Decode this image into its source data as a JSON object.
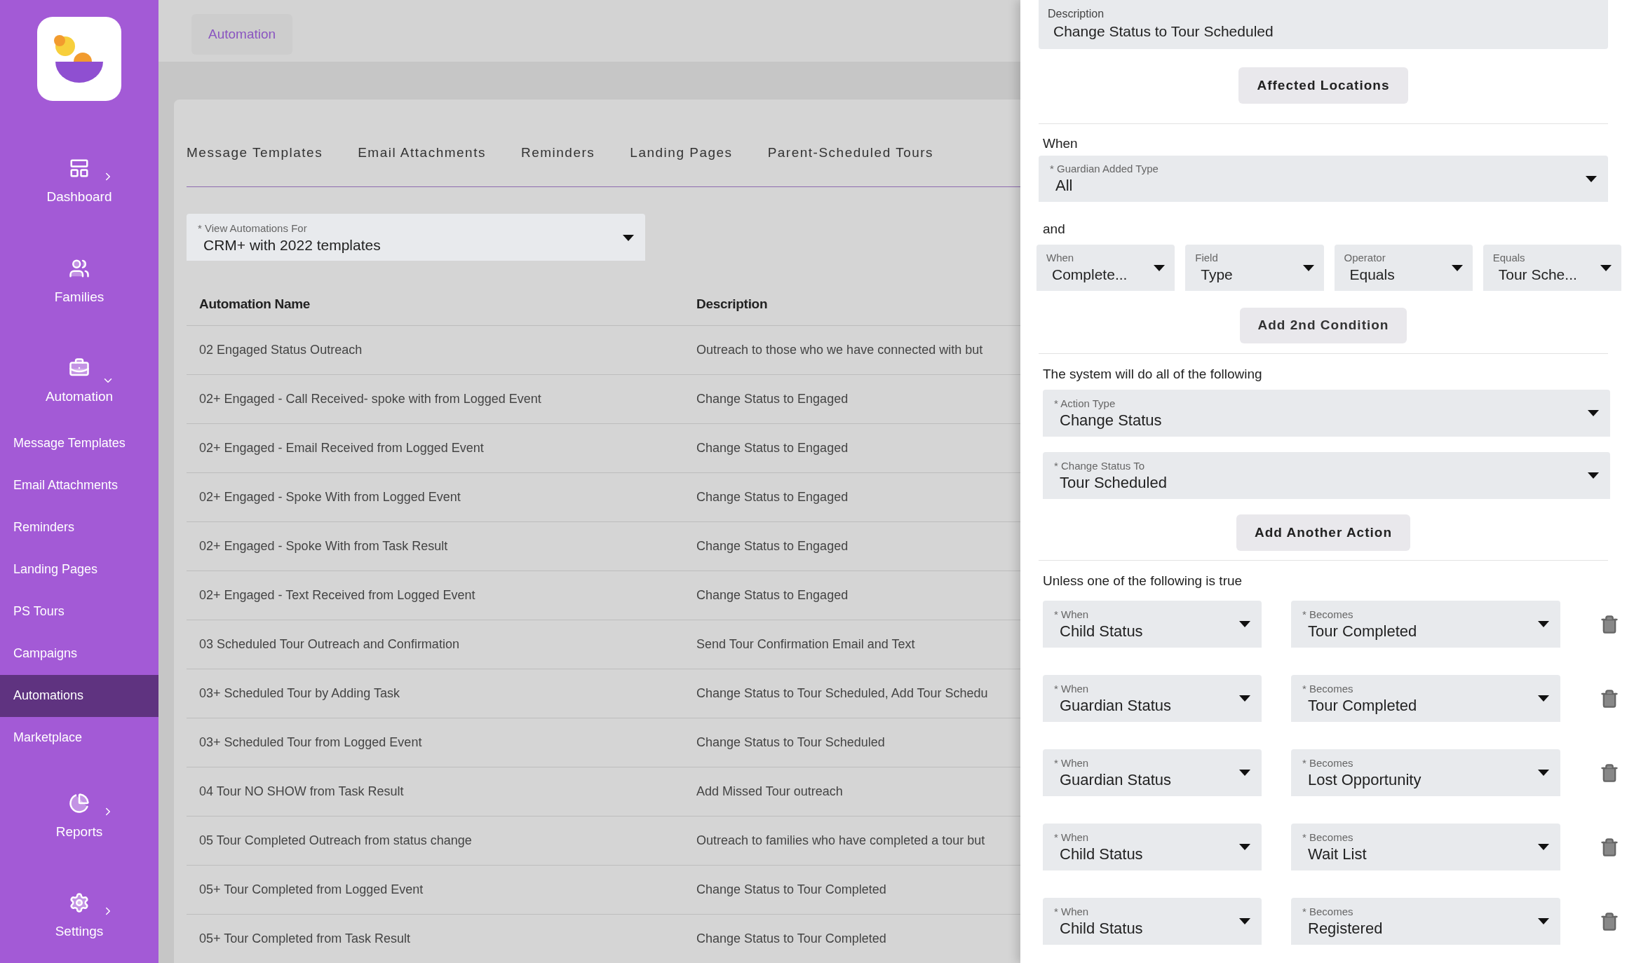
{
  "sidebar": {
    "items": [
      {
        "kind": "group",
        "label": "Dashboard",
        "expanded": false
      },
      {
        "kind": "link",
        "label": "Families"
      },
      {
        "kind": "group",
        "label": "Automation",
        "expanded": true
      },
      {
        "kind": "sub",
        "label": "Message Templates",
        "selected": false
      },
      {
        "kind": "sub",
        "label": "Email Attachments",
        "selected": false
      },
      {
        "kind": "sub",
        "label": "Reminders",
        "selected": false
      },
      {
        "kind": "sub",
        "label": "Landing Pages",
        "selected": false
      },
      {
        "kind": "sub",
        "label": "PS Tours",
        "selected": false
      },
      {
        "kind": "sub",
        "label": "Campaigns",
        "selected": false
      },
      {
        "kind": "sub",
        "label": "Automations",
        "selected": true
      },
      {
        "kind": "sub",
        "label": "Marketplace",
        "selected": false
      },
      {
        "kind": "group",
        "label": "Reports",
        "expanded": false
      },
      {
        "kind": "group",
        "label": "Settings",
        "expanded": false
      }
    ]
  },
  "breadcrumb": "Automation",
  "tabs": [
    {
      "label": "Message Templates",
      "selected": false
    },
    {
      "label": "Email Attachments",
      "selected": false
    },
    {
      "label": "Reminders",
      "selected": false
    },
    {
      "label": "Landing Pages",
      "selected": false
    },
    {
      "label": "Parent-Scheduled Tours",
      "selected": false
    }
  ],
  "view_select": {
    "label": "* View Automations For",
    "value": "CRM+ with 2022 templates"
  },
  "table": {
    "columns": [
      "Automation Name",
      "Description"
    ],
    "rows": [
      [
        "02 Engaged Status Outreach",
        "Outreach to those who we have connected with but"
      ],
      [
        "02+ Engaged - Call Received- spoke with from Logged Event",
        "Change Status to Engaged"
      ],
      [
        "02+ Engaged - Email Received from Logged Event",
        "Change Status to Engaged"
      ],
      [
        "02+ Engaged - Spoke With from Logged Event",
        "Change Status to Engaged"
      ],
      [
        "02+ Engaged - Spoke With from Task Result",
        "Change Status to Engaged"
      ],
      [
        "02+ Engaged - Text Received from Logged Event",
        "Change Status to Engaged"
      ],
      [
        "03 Scheduled Tour Outreach and Confirmation",
        "Send Tour Confirmation Email and Text"
      ],
      [
        "03+ Scheduled Tour by Adding Task",
        "Change Status to Tour Scheduled, Add Tour Schedu"
      ],
      [
        "03+ Scheduled Tour from Logged Event",
        "Change Status to Tour Scheduled"
      ],
      [
        "04 Tour NO SHOW from Task Result",
        "Add Missed Tour outreach"
      ],
      [
        "05 Tour Completed Outreach from status change",
        "Outreach to families who have completed a tour but"
      ],
      [
        "05+ Tour Completed from Logged Event",
        "Change Status to Tour Completed"
      ],
      [
        "05+ Tour Completed from Task Result",
        "Change Status to Tour Completed"
      ]
    ]
  },
  "panel": {
    "description": {
      "label": "Description",
      "value": "Change Status to Tour Scheduled"
    },
    "affected_button": "Affected Locations",
    "when_label": "When",
    "guardian_select": {
      "label": "* Guardian Added Type",
      "value": "All"
    },
    "and_label": "and",
    "conditions": [
      {
        "label": "When",
        "value": "Complete..."
      },
      {
        "label": "Field",
        "value": "Type"
      },
      {
        "label": "Operator",
        "value": "Equals"
      },
      {
        "label": "Equals",
        "value": "Tour Sche..."
      }
    ],
    "add_condition_button": "Add 2nd Condition",
    "actions_heading": "The system will do all of the following",
    "actions": [
      {
        "label": "* Action Type",
        "value": "Change Status"
      },
      {
        "label": "* Change Status To",
        "value": "Tour Scheduled"
      }
    ],
    "add_action_button": "Add Another Action",
    "unless_heading": "Unless one of the following is true",
    "exceptions": [
      {
        "when": {
          "label": "* When",
          "value": "Child Status"
        },
        "becomes": {
          "label": "* Becomes",
          "value": "Tour Completed"
        }
      },
      {
        "when": {
          "label": "* When",
          "value": "Guardian Status"
        },
        "becomes": {
          "label": "* Becomes",
          "value": "Tour Completed"
        }
      },
      {
        "when": {
          "label": "* When",
          "value": "Guardian Status"
        },
        "becomes": {
          "label": "* Becomes",
          "value": "Lost Opportunity"
        }
      },
      {
        "when": {
          "label": "* When",
          "value": "Child Status"
        },
        "becomes": {
          "label": "* Becomes",
          "value": "Wait List"
        }
      },
      {
        "when": {
          "label": "* When",
          "value": "Child Status"
        },
        "becomes": {
          "label": "* Becomes",
          "value": "Registered"
        }
      }
    ]
  }
}
